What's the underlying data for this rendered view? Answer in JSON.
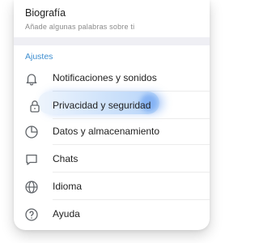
{
  "profile": {
    "bio_title": "Biografía",
    "bio_placeholder": "Añade algunas palabras sobre ti"
  },
  "settings": {
    "section_title": "Ajustes",
    "accent_color": "#3e8ed0",
    "items": [
      {
        "label": "Notificaciones y sonidos",
        "icon": "bell-icon"
      },
      {
        "label": "Privacidad y seguridad",
        "icon": "lock-icon",
        "highlighted": true
      },
      {
        "label": "Datos y almacenamiento",
        "icon": "clock-pie-icon"
      },
      {
        "label": "Chats",
        "icon": "chat-bubble-icon"
      },
      {
        "label": "Idioma",
        "icon": "globe-icon"
      },
      {
        "label": "Ayuda",
        "icon": "question-circle-icon"
      }
    ]
  }
}
